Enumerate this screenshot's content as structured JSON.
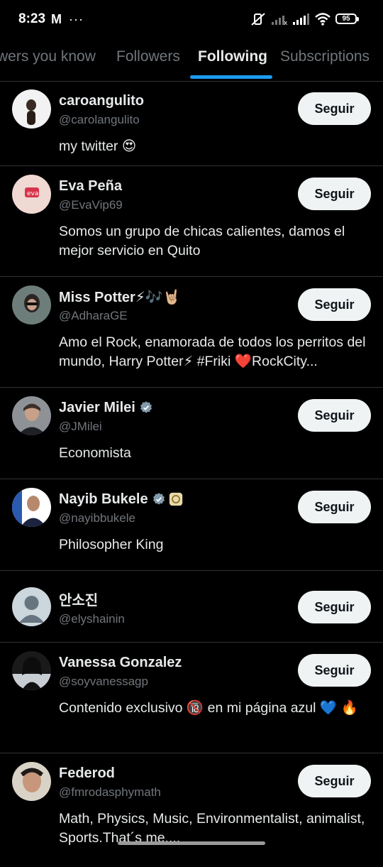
{
  "status_bar": {
    "time": "8:23",
    "mail_icon": "gmail-icon",
    "more": "···",
    "battery": "95"
  },
  "tabs": [
    {
      "label": "wers you know",
      "active": false
    },
    {
      "label": "Followers",
      "active": false
    },
    {
      "label": "Following",
      "active": true
    },
    {
      "label": "Subscriptions",
      "active": false
    }
  ],
  "users": [
    {
      "name": "caroangulito",
      "handle": "@carolangulito",
      "bio": "my twitter 😍",
      "button": "Seguir",
      "avatar_color": "#f2f2f2",
      "verified": false
    },
    {
      "name": "Eva Peña",
      "handle": "@EvaVip69",
      "bio": "Somos un grupo de chicas calientes, damos el mejor servicio en Quito",
      "button": "Seguir",
      "avatar_color": "#e8c9c0",
      "verified": false
    },
    {
      "name": "Miss Potter⚡🎶🤘🏼",
      "handle": "@AdharaGE",
      "bio": "Amo el Rock, enamorada de todos los perritos del mundo, Harry Potter⚡ #Friki ❤️RockCity...",
      "button": "Seguir",
      "avatar_color": "#5b6b6e",
      "verified": false
    },
    {
      "name": "Javier Milei",
      "handle": "@JMilei",
      "bio": "Economista",
      "button": "Seguir",
      "avatar_color": "#6f7780",
      "verified": true
    },
    {
      "name": "Nayib Bukele",
      "handle": "@nayibbukele",
      "bio": "Philosopher King",
      "button": "Seguir",
      "avatar_color": "#2a4f88",
      "verified": true
    },
    {
      "name": "안소진",
      "handle": "@elyshainin",
      "bio": "",
      "button": "Seguir",
      "avatar_color": "#ccd6dd",
      "verified": false
    },
    {
      "name": "Vanessa Gonzalez",
      "handle": "@soyvanessagp",
      "bio": "Contenido exclusivo 🔞 en mi página azul 💙 🔥",
      "button": "Seguir",
      "avatar_color": "#1c1c1c",
      "verified": false
    },
    {
      "name": "Federod",
      "handle": "@fmrodasphymath",
      "bio": "Math, Physics, Music, Environmentalist, animalist, Sports.That´s me....",
      "button": "Seguir",
      "avatar_color": "#c8a48a",
      "verified": false
    }
  ]
}
